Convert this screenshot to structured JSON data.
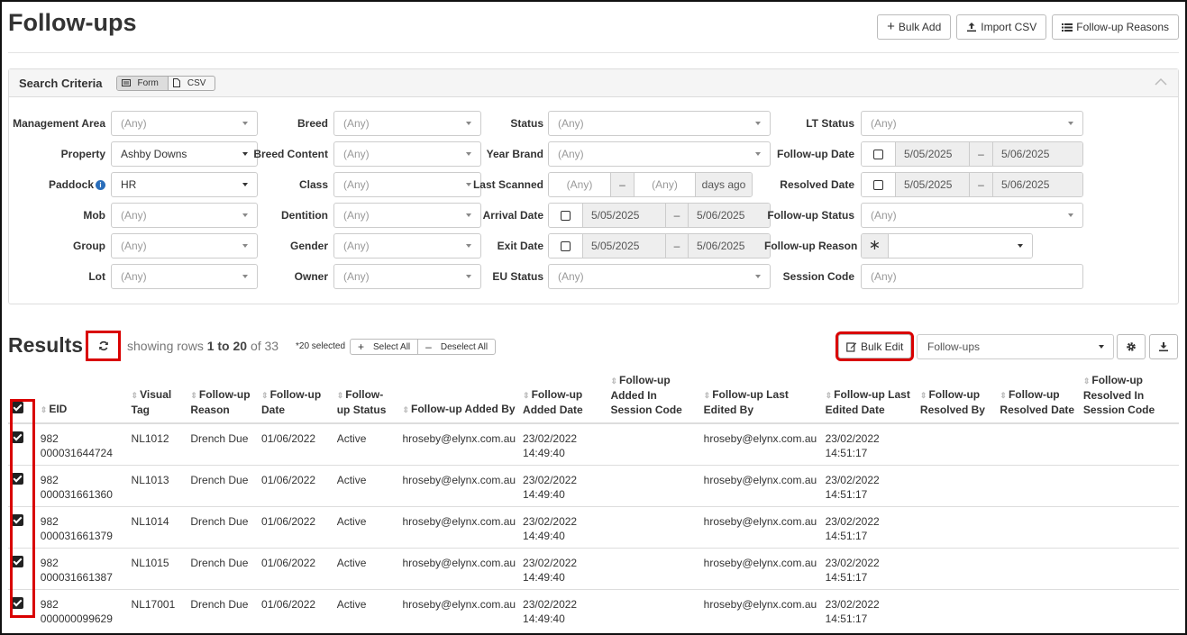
{
  "page": {
    "title": "Follow-ups",
    "actions": {
      "bulk_add": "Bulk Add",
      "import_csv": "Import CSV",
      "reasons": "Follow-up Reasons"
    }
  },
  "search": {
    "title": "Search Criteria",
    "mode_form": "Form",
    "mode_csv": "CSV",
    "any": "(Any)",
    "labels": {
      "management_area": "Management Area",
      "property": "Property",
      "paddock": "Paddock",
      "mob": "Mob",
      "group": "Group",
      "lot": "Lot",
      "breed": "Breed",
      "breed_content": "Breed Content",
      "class": "Class",
      "dentition": "Dentition",
      "gender": "Gender",
      "owner": "Owner",
      "status": "Status",
      "year_brand": "Year Brand",
      "last_scanned": "Last Scanned",
      "arrival_date": "Arrival Date",
      "exit_date": "Exit Date",
      "eu_status": "EU Status",
      "lt_status": "LT Status",
      "follow_up_date": "Follow-up Date",
      "resolved_date": "Resolved Date",
      "follow_up_status": "Follow-up Status",
      "follow_up_reason": "Follow-up Reason",
      "session_code": "Session Code"
    },
    "values": {
      "property": "Ashby Downs",
      "paddock": "HR",
      "days_ago": "days ago",
      "date_from": "5/05/2025",
      "date_to": "5/06/2025",
      "dash": "–",
      "asterisk": "∗"
    }
  },
  "results": {
    "title": "Results",
    "showing_prefix": "showing rows ",
    "range": "1 to 20",
    "of_text": " of 33",
    "selected": "*20 selected",
    "select_all": "Select All",
    "deselect_all": "Deselect All",
    "bulk_edit": "Bulk Edit",
    "view": "Follow-ups",
    "columns": {
      "eid": "EID",
      "visual_tag": "Visual Tag",
      "reason": "Follow-up Reason",
      "date": "Follow-up Date",
      "status": "Follow-up Status",
      "added_by": "Follow-up Added By",
      "added_date": "Follow-up Added Date",
      "added_session": "Follow-up Added In Session Code",
      "last_edited_by": "Follow-up Last Edited By",
      "last_edited_date": "Follow-up Last Edited Date",
      "resolved_by": "Follow-up Resolved By",
      "resolved_date": "Follow-up Resolved Date",
      "resolved_session": "Follow-up Resolved In Session Code"
    },
    "rows": [
      {
        "eid1": "982",
        "eid2": "000031644724",
        "tag": "NL1012",
        "reason": "Drench Due",
        "date": "01/06/2022",
        "status": "Active",
        "added_by": "hroseby@elynx.com.au",
        "added_d": "23/02/2022",
        "added_t": "14:49:40",
        "edited_by": "hroseby@elynx.com.au",
        "edited_d": "23/02/2022",
        "edited_t": "14:51:17"
      },
      {
        "eid1": "982",
        "eid2": "000031661360",
        "tag": "NL1013",
        "reason": "Drench Due",
        "date": "01/06/2022",
        "status": "Active",
        "added_by": "hroseby@elynx.com.au",
        "added_d": "23/02/2022",
        "added_t": "14:49:40",
        "edited_by": "hroseby@elynx.com.au",
        "edited_d": "23/02/2022",
        "edited_t": "14:51:17"
      },
      {
        "eid1": "982",
        "eid2": "000031661379",
        "tag": "NL1014",
        "reason": "Drench Due",
        "date": "01/06/2022",
        "status": "Active",
        "added_by": "hroseby@elynx.com.au",
        "added_d": "23/02/2022",
        "added_t": "14:49:40",
        "edited_by": "hroseby@elynx.com.au",
        "edited_d": "23/02/2022",
        "edited_t": "14:51:17"
      },
      {
        "eid1": "982",
        "eid2": "000031661387",
        "tag": "NL1015",
        "reason": "Drench Due",
        "date": "01/06/2022",
        "status": "Active",
        "added_by": "hroseby@elynx.com.au",
        "added_d": "23/02/2022",
        "added_t": "14:49:40",
        "edited_by": "hroseby@elynx.com.au",
        "edited_d": "23/02/2022",
        "edited_t": "14:51:17"
      },
      {
        "eid1": "982",
        "eid2": "000000099629",
        "tag": "NL17001",
        "reason": "Drench Due",
        "date": "01/06/2022",
        "status": "Active",
        "added_by": "hroseby@elynx.com.au",
        "added_d": "23/02/2022",
        "added_t": "14:49:40",
        "edited_by": "hroseby@elynx.com.au",
        "edited_d": "23/02/2022",
        "edited_t": "14:51:17"
      }
    ]
  }
}
